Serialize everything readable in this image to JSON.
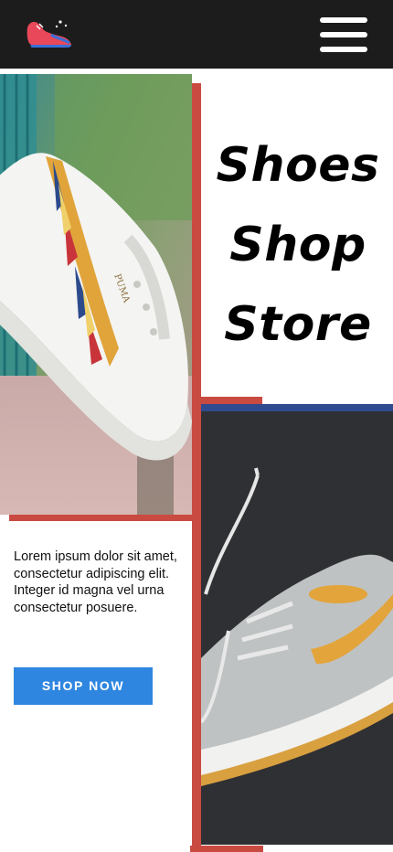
{
  "header": {
    "logo_icon": "sneaker-logo-icon",
    "menu_icon": "hamburger-menu-icon",
    "background": "#1c1c1c"
  },
  "hero": {
    "title_lines": [
      "Shoes",
      "Shop",
      "Store"
    ]
  },
  "intro": {
    "description": "Lorem ipsum dolor sit amet, consectetur adipiscing elit. Integer id magna vel urna consectetur posuere.",
    "cta_label": "SHOP NOW"
  },
  "colors": {
    "accent_red": "#c94a41",
    "accent_blue": "#2d4b8e",
    "button_blue": "#2f86e0"
  }
}
